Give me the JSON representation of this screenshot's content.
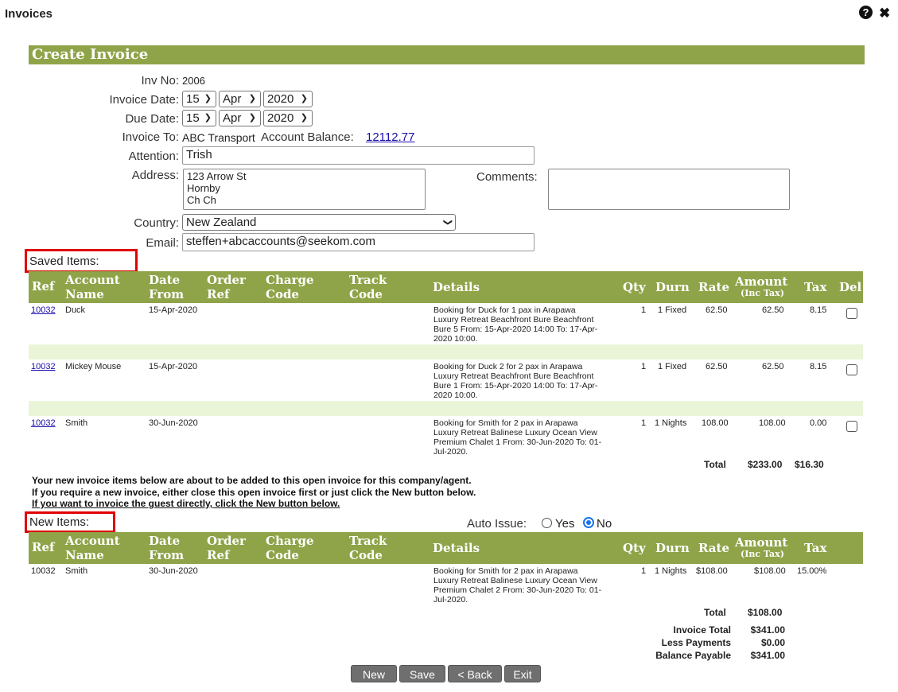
{
  "window": {
    "title": "Invoices"
  },
  "header": {
    "title": "Create Invoice"
  },
  "form": {
    "inv_no_label": "Inv No:",
    "inv_no": "2006",
    "invoice_date_label": "Invoice Date:",
    "invoice_date": {
      "day": "15",
      "month": "Apr",
      "year": "2020"
    },
    "due_date_label": "Due Date:",
    "due_date": {
      "day": "15",
      "month": "Apr",
      "year": "2020"
    },
    "invoice_to_label": "Invoice To:",
    "invoice_to": "ABC Transport",
    "account_balance_label": "Account Balance:",
    "account_balance": "12112.77",
    "attention_label": "Attention:",
    "attention": "Trish",
    "address_label": "Address:",
    "address": "123 Arrow St\nHornby\nCh Ch",
    "comments_label": "Comments:",
    "comments": "",
    "country_label": "Country:",
    "country": "New Zealand",
    "email_label": "Email:",
    "email": "steffen+abcaccounts@seekom.com"
  },
  "saved": {
    "label": "Saved Items:",
    "columns": {
      "ref": "Ref",
      "account1": "Account",
      "account2": "Name",
      "date1": "Date",
      "date2": "From",
      "order1": "Order",
      "order2": "Ref",
      "charge1": "Charge",
      "charge2": "Code",
      "track1": "Track",
      "track2": "Code",
      "details": "Details",
      "qty": "Qty",
      "durn": "Durn",
      "rate": "Rate",
      "amount": "Amount",
      "amount_sub": "(Inc Tax)",
      "tax": "Tax",
      "del": "Del"
    },
    "rows": [
      {
        "ref": "10032",
        "account": "Duck",
        "date": "15-Apr-2020",
        "details": "Booking for Duck for 1 pax in Arapawa\nLuxury Retreat Beachfront Bure Beachfront\nBure 5 From: 15-Apr-2020 14:00 To: 17-Apr-\n2020 10:00.",
        "qty": "1",
        "durn": "1 Fixed",
        "rate": "62.50",
        "amount": "62.50",
        "tax": "8.15"
      },
      {
        "ref": "10032",
        "account": "Mickey Mouse",
        "date": "15-Apr-2020",
        "details": "Booking for Duck 2 for 2 pax in Arapawa\nLuxury Retreat Beachfront Bure Beachfront\nBure 1 From: 15-Apr-2020 14:00 To: 17-Apr-\n2020 10:00.",
        "qty": "1",
        "durn": "1 Fixed",
        "rate": "62.50",
        "amount": "62.50",
        "tax": "8.15"
      },
      {
        "ref": "10032",
        "account": "Smith",
        "date": "30-Jun-2020",
        "details": "Booking for Smith for 2 pax in Arapawa\nLuxury Retreat Balinese Luxury Ocean View\nPremium Chalet 1 From: 30-Jun-2020 To: 01-\nJul-2020.",
        "qty": "1",
        "durn": "1 Nights",
        "rate": "108.00",
        "amount": "108.00",
        "tax": "0.00"
      }
    ],
    "total_label": "Total",
    "total_amount": "$233.00",
    "total_tax": "$16.30"
  },
  "notice": {
    "line1": "Your new invoice items below are about to be added to this open invoice for this company/agent.",
    "line2": "If you require a new invoice, either close this open invoice first or just click the New button below.",
    "line3": "If you want to invoice the guest directly, click the New button below."
  },
  "new_items": {
    "label": "New Items:",
    "auto_issue_label": "Auto Issue:",
    "yes": "Yes",
    "no": "No",
    "row": {
      "ref": "10032",
      "account": "Smith",
      "date": "30-Jun-2020",
      "details": "Booking for Smith for 2 pax in Arapawa\nLuxury Retreat Balinese Luxury Ocean View\nPremium Chalet 2 From: 30-Jun-2020 To: 01-\nJul-2020.",
      "qty": "1",
      "durn": "1 Nights",
      "rate": "$108.00",
      "amount": "$108.00",
      "tax": "15.00%"
    },
    "total_label": "Total",
    "total": "$108.00"
  },
  "summary": {
    "invoice_total_label": "Invoice Total",
    "invoice_total": "$341.00",
    "less_payments_label": "Less Payments",
    "less_payments": "$0.00",
    "balance_label": "Balance Payable",
    "balance": "$341.00"
  },
  "buttons": {
    "new": "New",
    "save": "Save",
    "back": "< Back",
    "exit": "Exit"
  },
  "colors": {
    "header_bg": "#8fa449",
    "band": "#eaf5d8",
    "highlight": "#e00000"
  }
}
